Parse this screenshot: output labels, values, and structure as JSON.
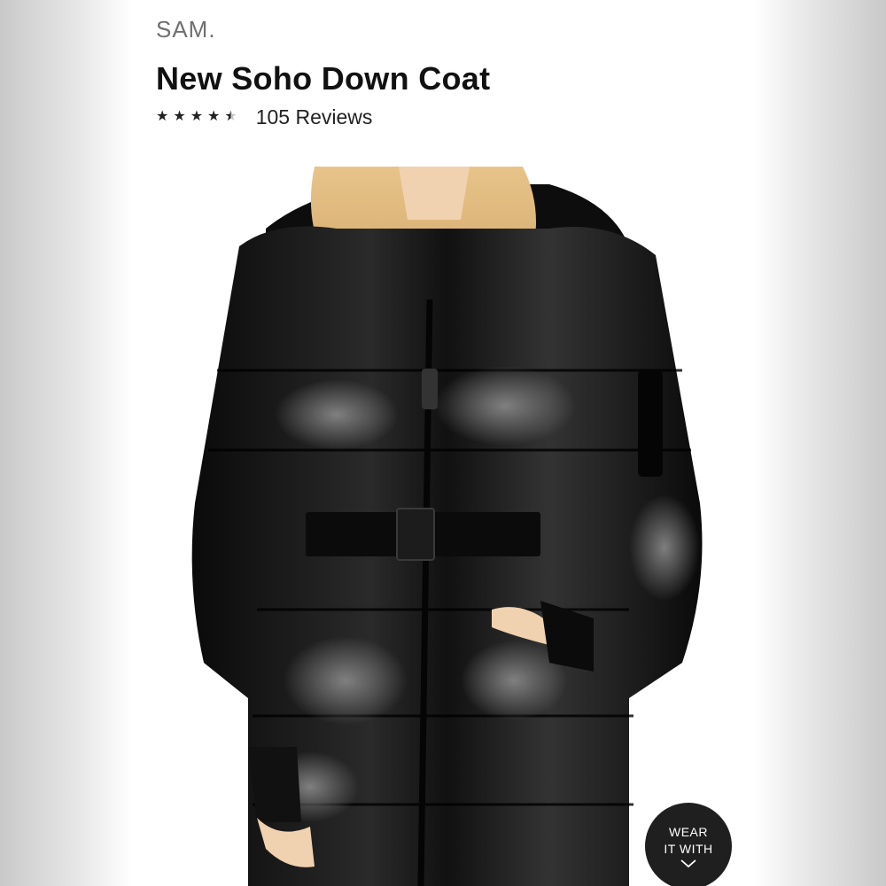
{
  "brand": "SAM.",
  "product": {
    "title": "New Soho Down Coat",
    "rating": {
      "stars_filled": 4.5,
      "stars_total": 5,
      "reviews_label": "105 Reviews"
    },
    "image_alt_icon": "product-photo"
  },
  "wear_it_with": {
    "line1": "WEAR",
    "line2": "IT WITH",
    "icon": "chevron-down-icon"
  },
  "colors": {
    "text_dark": "#111111",
    "text_brand": "#6f6f6f",
    "button_bg": "#1f1f1f"
  }
}
